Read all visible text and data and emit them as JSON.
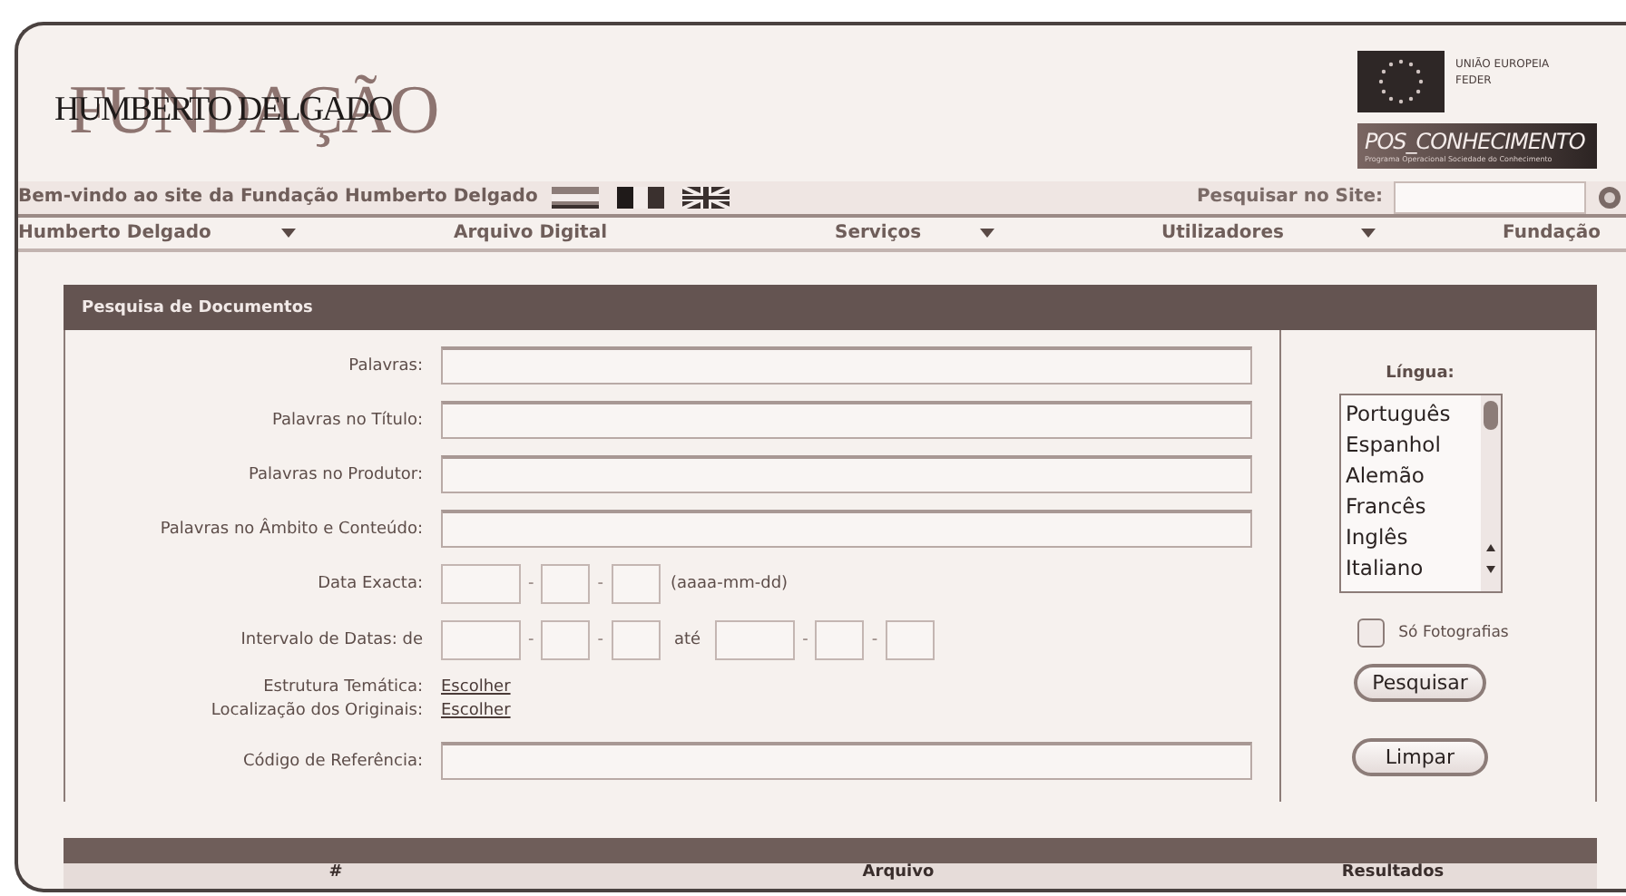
{
  "header": {
    "logo": {
      "line1": "FUNDAÇÃO",
      "line2": "HUMBERTO DELGADO"
    },
    "eu_badge": {
      "lines": [
        "UNIÃO EUROPEIA",
        "FEDER"
      ]
    },
    "pos_banner": {
      "title": "POS_CONHECIMENTO",
      "subtitle": "Programa Operacional Sociedade do Conhecimento"
    }
  },
  "welcome_bar": {
    "text": "Bem-vindo ao site da Fundação Humberto Delgado",
    "languages": [
      {
        "kind": "es"
      },
      {
        "kind": "fr"
      },
      {
        "kind": "uk"
      }
    ],
    "search": {
      "label": "Pesquisar no Site:"
    }
  },
  "nav": [
    {
      "label": "Humberto Delgado",
      "dropdown": true
    },
    {
      "label": "Arquivo Digital",
      "dropdown": false
    },
    {
      "label": "Serviços",
      "dropdown": true
    },
    {
      "label": "Utilizadores",
      "dropdown": true
    },
    {
      "label": "Fundação",
      "dropdown": false
    }
  ],
  "panel": {
    "title": "Pesquisa de Documentos",
    "fields": [
      {
        "kind": "text",
        "label": "Palavras:"
      },
      {
        "kind": "text",
        "label": "Palavras no Título:"
      },
      {
        "kind": "text",
        "label": "Palavras no Produtor:"
      },
      {
        "kind": "text",
        "label": "Palavras no Âmbito e Conteúdo:"
      },
      {
        "kind": "date",
        "label": "Data Exacta:",
        "separators": [
          "-",
          "-"
        ],
        "hint": "(aaaa-mm-dd)"
      },
      {
        "kind": "range",
        "label": "Intervalo de Datas: de",
        "separators": [
          "-",
          "-",
          "-",
          "-"
        ],
        "to": "até"
      },
      {
        "kind": "link",
        "label": "Estrutura Temática:",
        "link": "Escolher"
      },
      {
        "kind": "link",
        "label": "Localização dos Originais:",
        "link": "Escolher"
      },
      {
        "kind": "text",
        "label": "Código de Referência:"
      }
    ],
    "language": {
      "label": "Língua:",
      "options": [
        {
          "label": "Português",
          "selected": false
        },
        {
          "label": "Espanhol",
          "selected": false
        },
        {
          "label": "Alemão",
          "selected": false
        },
        {
          "label": "Francês",
          "selected": false
        },
        {
          "label": "Inglês",
          "selected": false
        },
        {
          "label": "Italiano",
          "selected": false
        }
      ]
    },
    "photos_only": {
      "label": "Só Fotografias",
      "checked": false
    },
    "buttons": [
      "Pesquisar",
      "Limpar"
    ]
  },
  "results_table": {
    "columns": [
      "#",
      "Arquivo",
      "Resultados"
    ]
  }
}
